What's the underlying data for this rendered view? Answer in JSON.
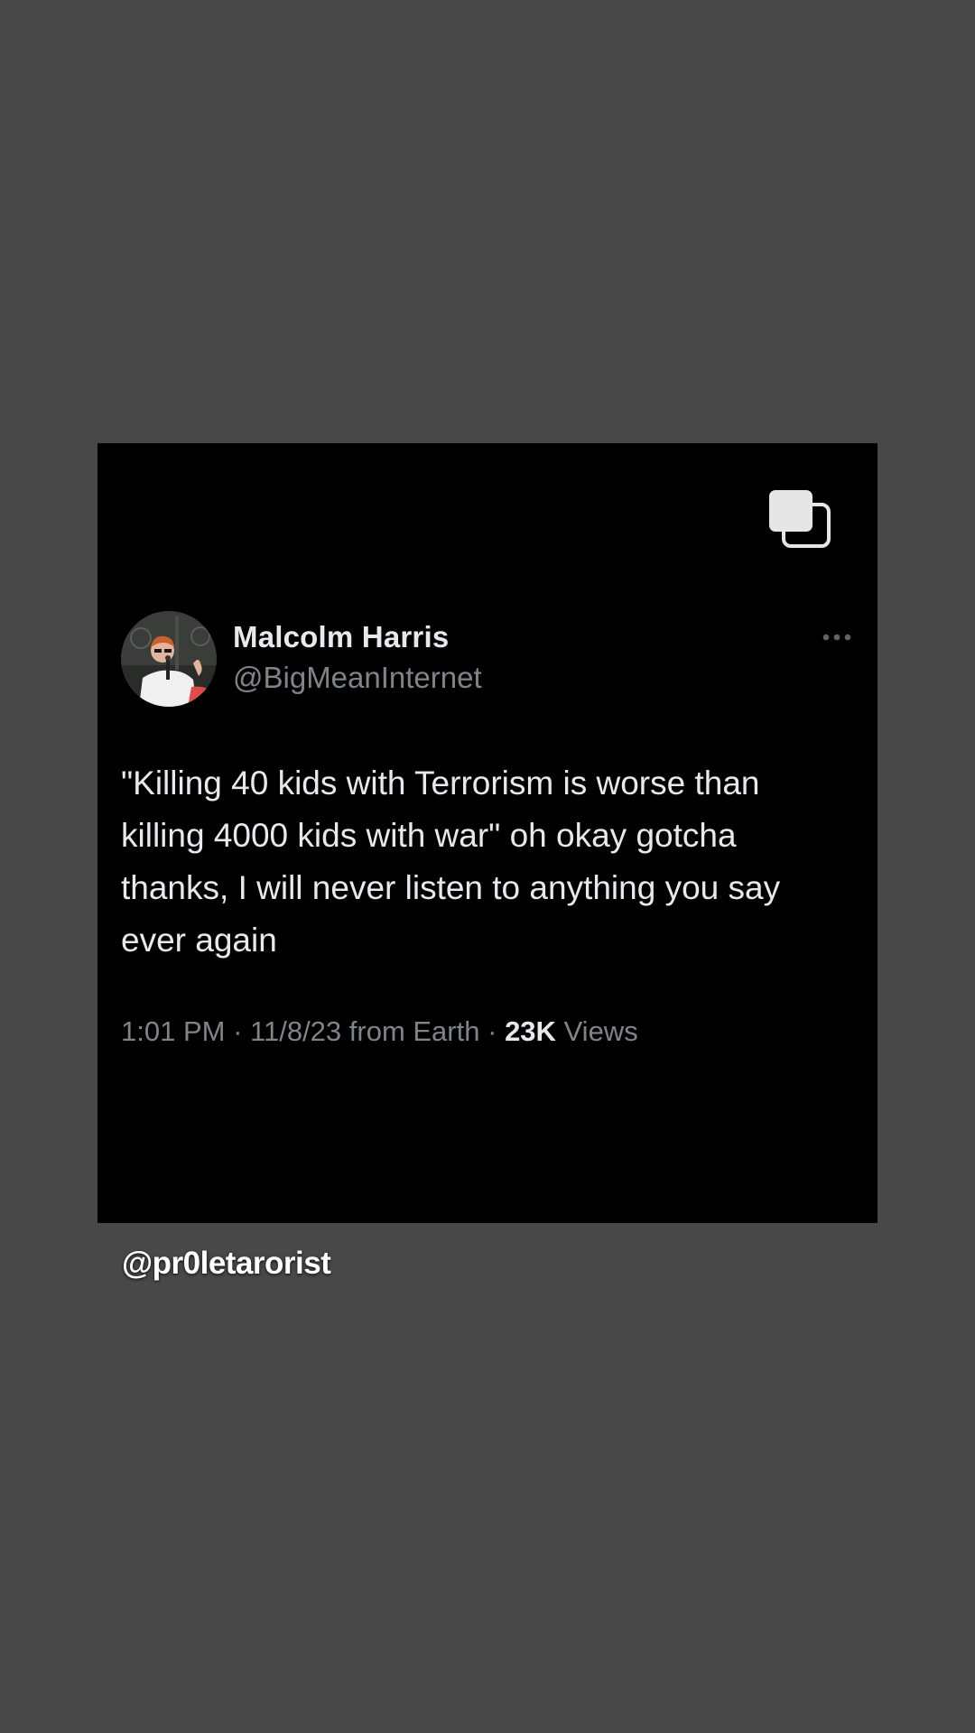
{
  "post": {
    "author": {
      "display_name": "Malcolm Harris",
      "handle": "@BigMeanInternet",
      "avatar_icon": "profile-photo"
    },
    "text": "\"Killing 40 kids with Terrorism is worse than\nkilling 4000 kids with war\" oh okay gotcha\nthanks, I will never listen to anything you say\never again",
    "meta": {
      "time": "1:01 PM",
      "separator": "·",
      "date_source": "11/8/23 from Earth",
      "views_count": "23K",
      "views_label": "Views"
    },
    "icons": {
      "top_right": "multiple-images-icon",
      "overflow": "more-options-icon"
    }
  },
  "watermark": "@pr0letarorist",
  "colors": {
    "page_background": "#484848",
    "card_background": "#000000",
    "primary_text": "#e7e9ea",
    "secondary_text": "#7f8489"
  }
}
